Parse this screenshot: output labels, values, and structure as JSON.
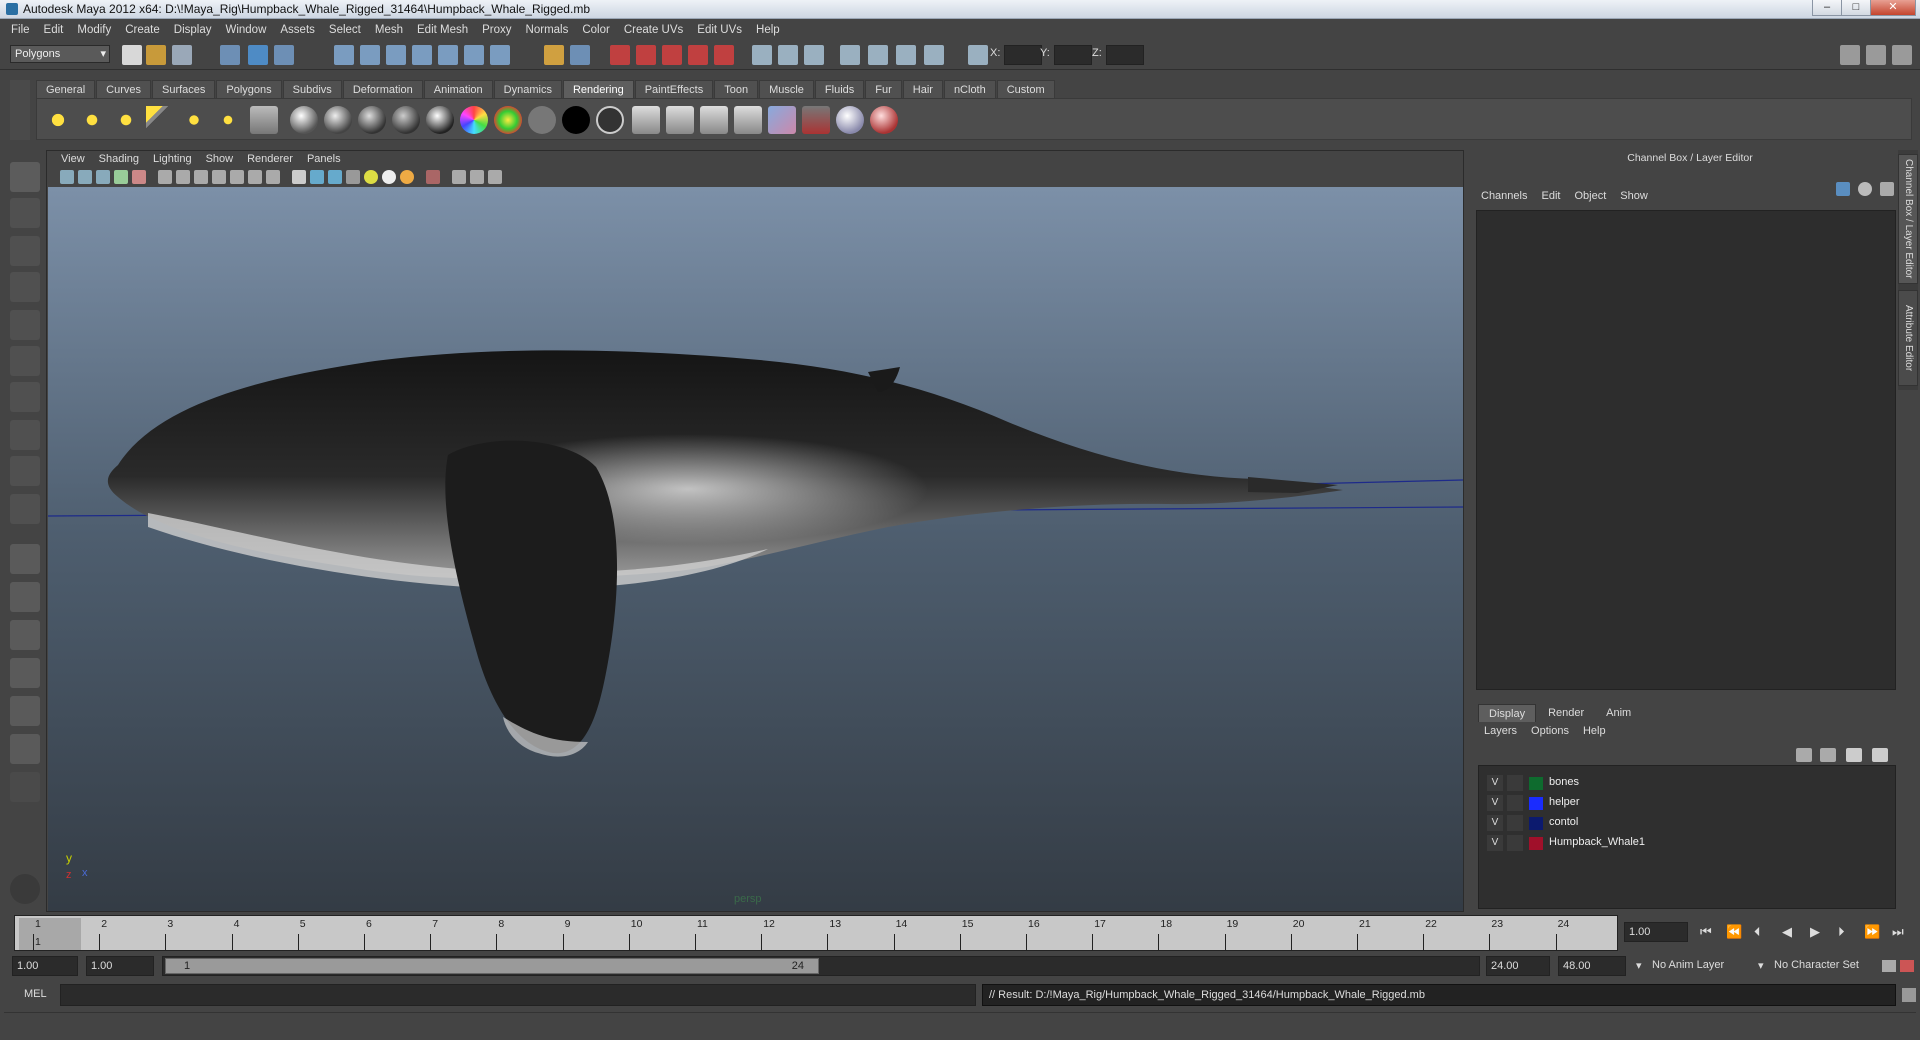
{
  "window": {
    "title": "Autodesk Maya 2012 x64: D:\\!Maya_Rig\\Humpback_Whale_Rigged_31464\\Humpback_Whale_Rigged.mb",
    "buttons": {
      "minimize": "–",
      "maximize": "□",
      "close": "✕"
    }
  },
  "menu": [
    "File",
    "Edit",
    "Modify",
    "Create",
    "Display",
    "Window",
    "Assets",
    "Select",
    "Mesh",
    "Edit Mesh",
    "Proxy",
    "Normals",
    "Color",
    "Create UVs",
    "Edit UVs",
    "Help"
  ],
  "statusline": {
    "mode": "Polygons",
    "x_label": "X:",
    "y_label": "Y:",
    "z_label": "Z:"
  },
  "shelf": {
    "tabs": [
      "General",
      "Curves",
      "Surfaces",
      "Polygons",
      "Subdivs",
      "Deformation",
      "Animation",
      "Dynamics",
      "Rendering",
      "PaintEffects",
      "Toon",
      "Muscle",
      "Fluids",
      "Fur",
      "Hair",
      "nCloth",
      "Custom"
    ],
    "active_tab": "Rendering"
  },
  "viewport": {
    "menu": [
      "View",
      "Shading",
      "Lighting",
      "Show",
      "Renderer",
      "Panels"
    ],
    "camera_label": "persp",
    "axes": {
      "y": "y",
      "x": "x",
      "z": "z"
    }
  },
  "channel_box": {
    "title": "Channel Box / Layer Editor",
    "menu": [
      "Channels",
      "Edit",
      "Object",
      "Show"
    ],
    "side_tabs": [
      "Channel Box / Layer Editor",
      "Attribute Editor"
    ]
  },
  "layer_editor": {
    "tabs": [
      "Display",
      "Render",
      "Anim"
    ],
    "active_tab": "Display",
    "menu": [
      "Layers",
      "Options",
      "Help"
    ],
    "layers": [
      {
        "visible": "V",
        "name": "bones",
        "color": "#0e6b2e"
      },
      {
        "visible": "V",
        "name": "helper",
        "color": "#1a2cff"
      },
      {
        "visible": "V",
        "name": "contol",
        "color": "#0c1a6e"
      },
      {
        "visible": "V",
        "name": "Humpback_Whale1",
        "color": "#a0102a"
      }
    ]
  },
  "time_slider": {
    "frames": [
      "1",
      "2",
      "3",
      "4",
      "5",
      "6",
      "7",
      "8",
      "9",
      "10",
      "11",
      "12",
      "13",
      "14",
      "15",
      "16",
      "17",
      "18",
      "19",
      "20",
      "21",
      "22",
      "23",
      "24"
    ],
    "current_frame_label": "1",
    "current_time": "1.00"
  },
  "range_slider": {
    "start_time": "1.00",
    "playback_start": "1.00",
    "range_start_label": "1",
    "range_end_label": "24",
    "playback_end": "24.00",
    "end_time": "48.00",
    "anim_layer": "No Anim Layer",
    "character_set": "No Character Set"
  },
  "command_line": {
    "mel_label": "MEL",
    "result": "// Result: D:/!Maya_Rig/Humpback_Whale_Rigged_31464/Humpback_Whale_Rigged.mb"
  }
}
